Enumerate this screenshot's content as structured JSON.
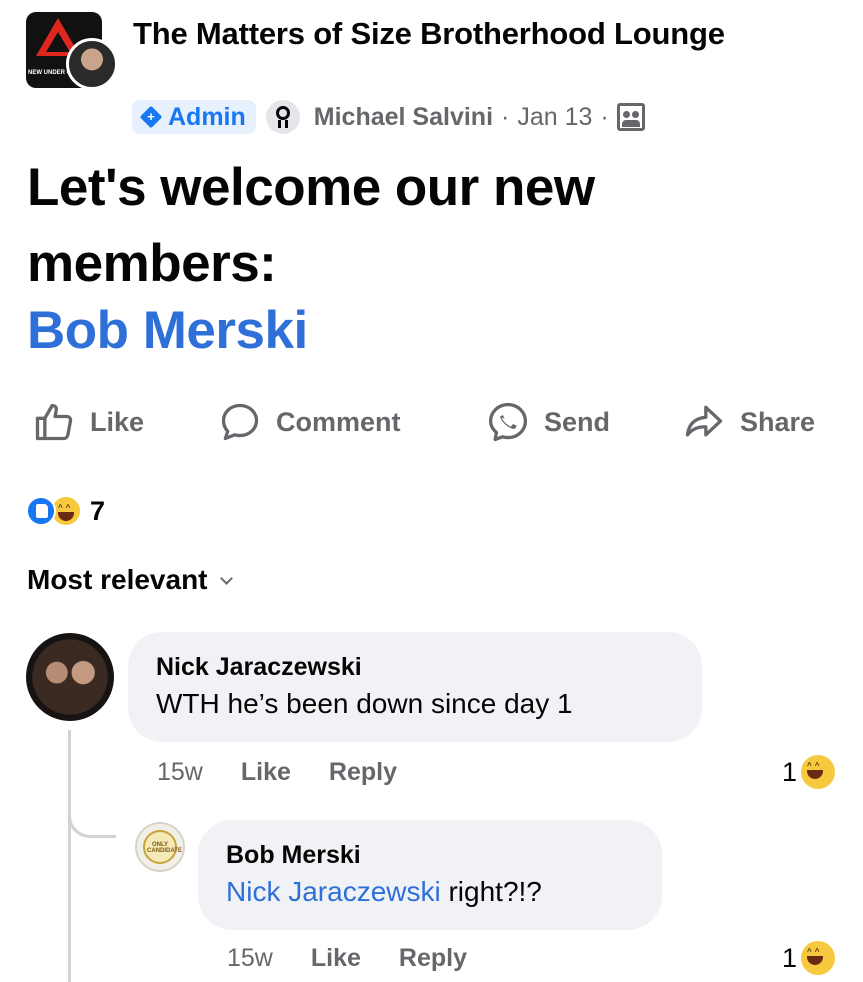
{
  "post": {
    "group_name": "The Matters of Size Brotherhood Lounge",
    "group_logo_text": "NEW UNDER CON",
    "admin_badge": "Admin",
    "author": "Michael Salvini",
    "separator": "·",
    "date": "Jan 13",
    "body_text": "Let's welcome our new members:",
    "mention": "Bob Merski"
  },
  "actions": {
    "like": "Like",
    "comment": "Comment",
    "send": "Send",
    "share": "Share"
  },
  "reactions": {
    "count": "7",
    "types": [
      "like",
      "haha"
    ]
  },
  "sort": {
    "label": "Most relevant"
  },
  "comments": [
    {
      "author": "Nick Jaraczewski",
      "text": "WTH he’s been down since day 1",
      "time": "15w",
      "like_label": "Like",
      "reply_label": "Reply",
      "reaction_count": "1"
    },
    {
      "author": "Bob Merski",
      "mention": "Nick Jaraczewski",
      "text": " right?!?",
      "avatar_text": "ONLY CANDIDATE",
      "time": "15w",
      "like_label": "Like",
      "reply_label": "Reply",
      "reaction_count": "1"
    }
  ],
  "colors": {
    "accent": "#1877f2",
    "mention": "#2e6fd8",
    "secondary_text": "#65676b",
    "bubble": "#f0f2f5",
    "haha": "#f7c93e"
  }
}
